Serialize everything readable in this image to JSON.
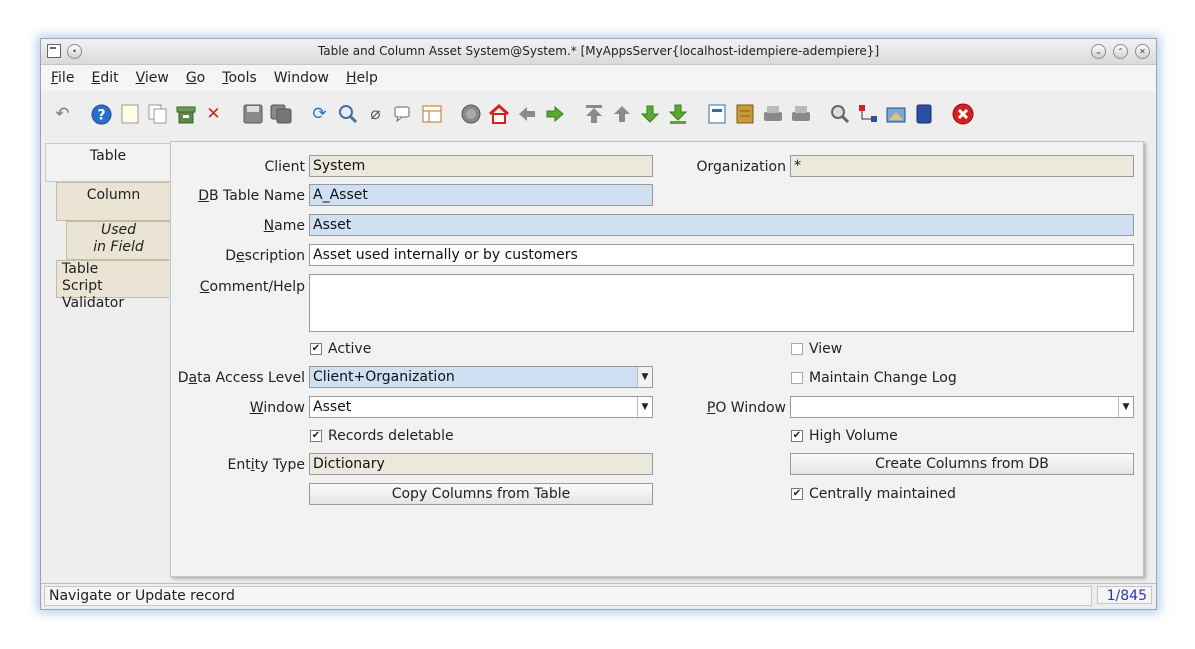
{
  "window": {
    "title": "Table and Column  Asset  System@System.* [MyAppsServer{localhost-idempiere-adempiere}]"
  },
  "menu": {
    "items": [
      {
        "pre": "",
        "u": "F",
        "post": "ile"
      },
      {
        "pre": "",
        "u": "E",
        "post": "dit"
      },
      {
        "pre": "",
        "u": "V",
        "post": "iew"
      },
      {
        "pre": "",
        "u": "G",
        "post": "o"
      },
      {
        "pre": "",
        "u": "T",
        "post": "ools"
      },
      {
        "pre": "Window",
        "u": "",
        "post": ""
      },
      {
        "pre": "",
        "u": "H",
        "post": "elp"
      }
    ]
  },
  "toolbar": {
    "icons": [
      "undo-icon",
      "help-icon",
      "new-record-icon",
      "copy-record-icon",
      "archive-icon",
      "delete-icon",
      "save-icon",
      "save-copy-icon",
      "refresh-icon",
      "find-icon",
      "attachment-icon",
      "chat-icon",
      "grid-toggle-icon",
      "history-icon",
      "home-icon",
      "back-icon",
      "forward-icon",
      "first-record-icon",
      "previous-record-icon",
      "next-record-icon",
      "last-record-icon",
      "report-icon",
      "archived-docs-icon",
      "print-preview-icon",
      "print-icon",
      "zoom-across-icon",
      "workflow-icon",
      "requests-icon",
      "product-info-icon",
      "exit-icon"
    ]
  },
  "tabs": [
    {
      "label": "Table"
    },
    {
      "label": "Column"
    },
    {
      "label1": "Used",
      "label2": "in Field"
    },
    {
      "label1": "Table",
      "label2": "Script Validator"
    }
  ],
  "form": {
    "client": {
      "label": "Client",
      "value": "System"
    },
    "organization": {
      "label": "Organization",
      "value": "*"
    },
    "db_table_name": {
      "label_u": "D",
      "label_rest": "B Table Name",
      "value": "A_Asset"
    },
    "name": {
      "label_u": "N",
      "label_rest": "ame",
      "value": "Asset"
    },
    "description": {
      "label_pre": "D",
      "label_u": "e",
      "label_rest": "scription",
      "value": "Asset used internally or by customers"
    },
    "comment_help": {
      "label_u": "C",
      "label_rest": "omment/Help",
      "value": ""
    },
    "active": {
      "label": "Active",
      "checked": true
    },
    "view": {
      "label": "View",
      "checked": false
    },
    "data_access_level": {
      "label_pre": "D",
      "label_u": "a",
      "label_rest": "ta Access Level",
      "value": "Client+Organization"
    },
    "maintain_change_log": {
      "label": "Maintain Change Log",
      "checked": false
    },
    "window": {
      "label_u": "W",
      "label_rest": "indow",
      "value": "Asset"
    },
    "po_window": {
      "label_u": "P",
      "label_rest": "O Window",
      "value": ""
    },
    "records_deletable": {
      "label": "Records deletable",
      "checked": true
    },
    "high_volume": {
      "label": "High Volume",
      "checked": true
    },
    "entity_type": {
      "label_pre": "Ent",
      "label_u": "i",
      "label_rest": "ty Type",
      "value": "Dictionary"
    },
    "create_columns_button": "Create Columns from DB",
    "copy_columns_button": "Copy Columns from Table",
    "centrally_maintained": {
      "label": "Centrally maintained",
      "checked": true
    }
  },
  "status": {
    "message": "Navigate or Update record",
    "record_count": "1/845"
  },
  "colors": {
    "mandatory_field": "#cfe0f2",
    "readonly_field": "#ebe9dc",
    "tab_inactive": "#e9e4d3",
    "window_glow": "#78aadc"
  }
}
